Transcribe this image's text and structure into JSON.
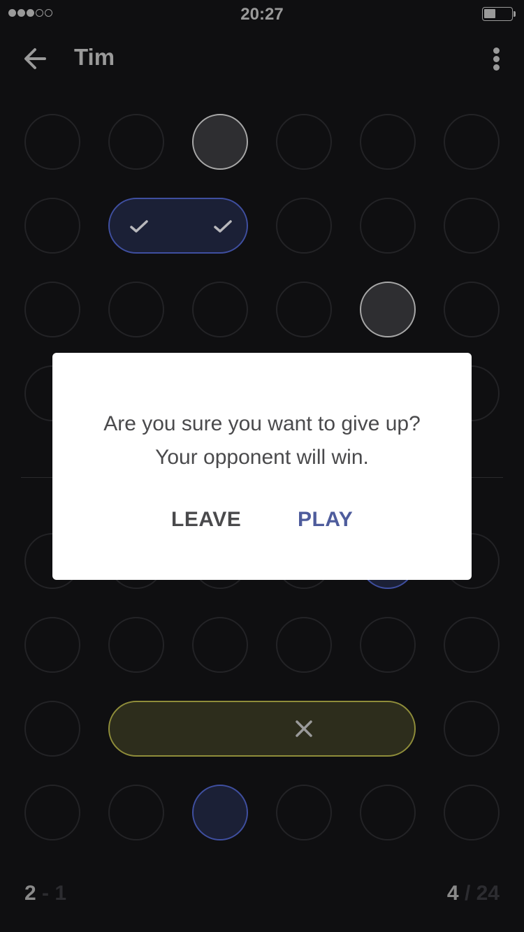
{
  "status_bar": {
    "time": "20:27",
    "signal_bars_filled": 3,
    "signal_bars_total": 5,
    "battery_level": 0.4
  },
  "header": {
    "title": "Tim",
    "back_icon": "arrow-left-icon",
    "menu_icon": "more-vertical-icon"
  },
  "board": {
    "rows": 8,
    "cols": 6,
    "selected_pill_icons": [
      "check-icon",
      "check-icon"
    ],
    "wrong_pill_icon": "close-icon"
  },
  "footer": {
    "score_player": "2",
    "score_separator": "-",
    "score_opponent": "1",
    "moves_current": "4",
    "moves_separator": "/",
    "moves_total": "24"
  },
  "dialog": {
    "message_line1": "Are you sure you want to give up?",
    "message_line2": "Your opponent will win.",
    "leave_label": "LEAVE",
    "play_label": "PLAY"
  },
  "colors": {
    "background": "#0f0f11",
    "blue_accent": "#3f4fa0",
    "yellow_accent": "#8f8d3a",
    "play_button": "#4e5c9c"
  }
}
